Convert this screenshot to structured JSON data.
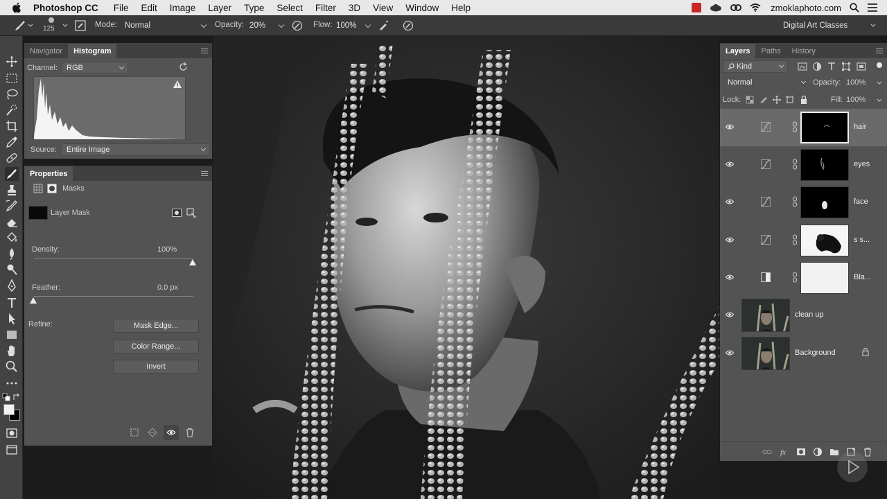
{
  "menubar": {
    "app_name": "Photoshop CC",
    "items": [
      "File",
      "Edit",
      "Image",
      "Layer",
      "Type",
      "Select",
      "Filter",
      "3D",
      "View",
      "Window",
      "Help"
    ],
    "domain": "zmoklaphoto.com"
  },
  "options_bar": {
    "brush_size": "125",
    "mode_label": "Mode:",
    "mode_value": "Normal",
    "opacity_label": "Opacity:",
    "opacity_value": "20%",
    "flow_label": "Flow:",
    "flow_value": "100%",
    "workspace": "Digital Art Classes"
  },
  "histogram_panel": {
    "tabs": [
      "Navigator",
      "Histogram"
    ],
    "active_tab": "Histogram",
    "channel_label": "Channel:",
    "channel_value": "RGB",
    "source_label": "Source:",
    "source_value": "Entire Image"
  },
  "properties_panel": {
    "title": "Properties",
    "section": "Masks",
    "mask_type": "Layer Mask",
    "density_label": "Density:",
    "density_value": "100%",
    "feather_label": "Feather:",
    "feather_value": "0.0 px",
    "refine_label": "Refine:",
    "buttons": {
      "mask_edge": "Mask Edge...",
      "color_range": "Color Range...",
      "invert": "Invert"
    }
  },
  "layers_panel": {
    "tabs": [
      "Layers",
      "Paths",
      "History"
    ],
    "active_tab": "Layers",
    "filter_kind": "Kind",
    "blend_mode": "Normal",
    "opacity_label": "Opacity:",
    "opacity_value": "100%",
    "lock_label": "Lock:",
    "fill_label": "Fill:",
    "fill_value": "100%",
    "layers": [
      {
        "name": "hair",
        "selected": true
      },
      {
        "name": "eyes",
        "selected": false
      },
      {
        "name": "face",
        "selected": false
      },
      {
        "name": "s s...",
        "selected": false
      },
      {
        "name": "Bla...",
        "selected": false
      },
      {
        "name": "clean up",
        "selected": false
      },
      {
        "name": "Background",
        "selected": false,
        "locked": true
      }
    ]
  },
  "colors": {
    "panel_bg": "#535353",
    "panel_header": "#404040",
    "toolbar_bg": "#434343",
    "options_bg": "#3a3a3a",
    "selected_layer": "#6a6a6a",
    "menubar_bg": "#e8e8e8",
    "record_red": "#c62828"
  }
}
